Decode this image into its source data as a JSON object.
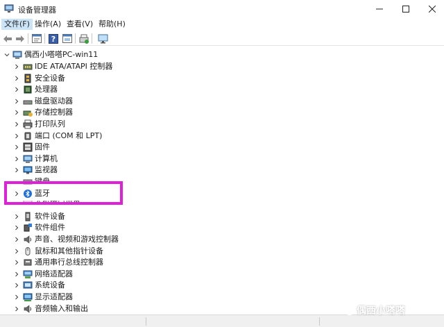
{
  "window": {
    "title": "设备管理器",
    "controls": [
      "minimize",
      "maximize",
      "close"
    ]
  },
  "menu": {
    "items": [
      "文件(F)",
      "操作(A)",
      "查看(V)",
      "帮助(H)"
    ],
    "active_index": 0
  },
  "toolbar": {
    "buttons": [
      "back-icon",
      "forward-icon",
      "properties-icon",
      "help-icon",
      "details-icon",
      "update-driver-icon",
      "monitor-icon"
    ]
  },
  "tree": {
    "root": "偶西小嗒嗒PC-win11",
    "children": [
      {
        "label": "IDE ATA/ATAPI 控制器",
        "icon": "ide-controller-icon"
      },
      {
        "label": "安全设备",
        "icon": "security-device-icon"
      },
      {
        "label": "处理器",
        "icon": "processor-icon"
      },
      {
        "label": "磁盘驱动器",
        "icon": "disk-drive-icon"
      },
      {
        "label": "存储控制器",
        "icon": "storage-controller-icon"
      },
      {
        "label": "打印队列",
        "icon": "printer-icon"
      },
      {
        "label": "端口 (COM 和 LPT)",
        "icon": "port-icon"
      },
      {
        "label": "固件",
        "icon": "firmware-icon"
      },
      {
        "label": "计算机",
        "icon": "computer-icon"
      },
      {
        "label": "监视器",
        "icon": "monitor-icon"
      },
      {
        "label": "键盘",
        "icon": "keyboard-icon"
      },
      {
        "label": "蓝牙",
        "icon": "bluetooth-icon"
      },
      {
        "label": "人机接口设备",
        "icon": "hid-icon"
      },
      {
        "label": "软件设备",
        "icon": "software-device-icon"
      },
      {
        "label": "软件组件",
        "icon": "software-component-icon"
      },
      {
        "label": "声音、视频和游戏控制器",
        "icon": "audio-icon"
      },
      {
        "label": "鼠标和其他指针设备",
        "icon": "mouse-icon"
      },
      {
        "label": "通用串行总线控制器",
        "icon": "usb-icon"
      },
      {
        "label": "网络适配器",
        "icon": "network-adapter-icon"
      },
      {
        "label": "系统设备",
        "icon": "system-device-icon"
      },
      {
        "label": "显示适配器",
        "icon": "display-adapter-icon"
      },
      {
        "label": "音频输入和输出",
        "icon": "audio-io-icon"
      }
    ]
  },
  "watermark": "偶西小嗒嗒",
  "colors": {
    "highlight": "#e020d8",
    "menu_active": "#cce4f7",
    "icon_blue": "#1e6fd9"
  }
}
